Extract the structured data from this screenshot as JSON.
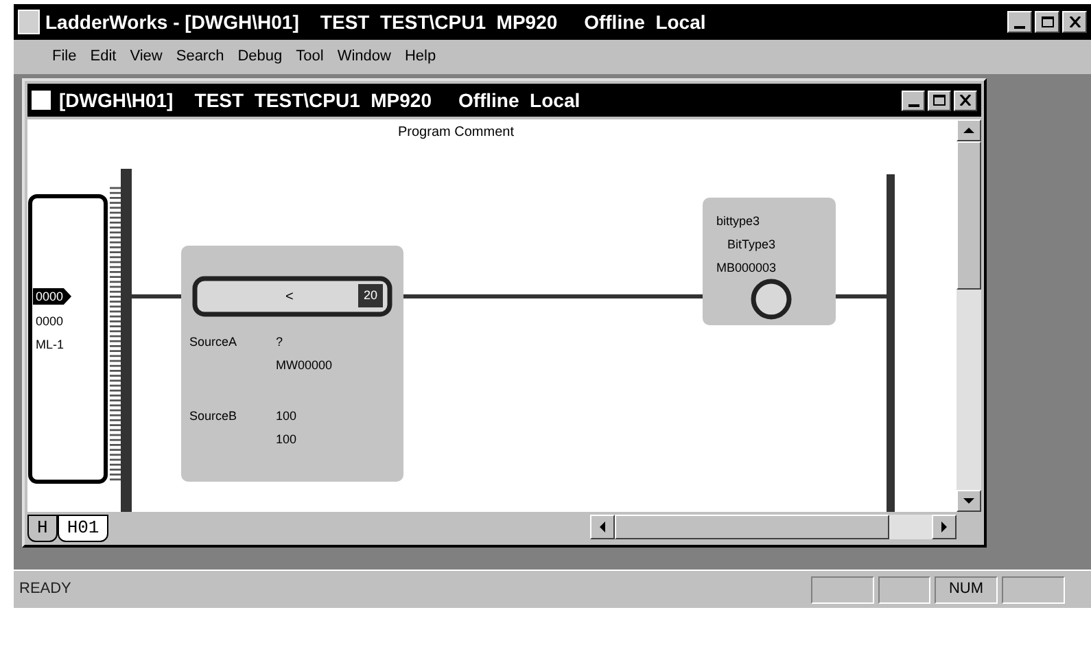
{
  "window": {
    "title": "LadderWorks - [DWGH\\H01]    TEST  TEST\\CPU1  MP920     Offline  Local"
  },
  "menu": [
    "File",
    "Edit",
    "View",
    "Search",
    "Debug",
    "Tool",
    "Window",
    "Help"
  ],
  "child_window": {
    "title": "[DWGH\\H01]    TEST  TEST\\CPU1  MP920     Offline  Local"
  },
  "ladder": {
    "program_comment": "Program Comment",
    "left_block": {
      "selected_label": "0000",
      "lines": [
        "0000",
        "ML-1"
      ]
    },
    "compare": {
      "operator": "<",
      "badge": "20",
      "operands": [
        {
          "name": "SourceA",
          "lines": [
            "?",
            "MW00000"
          ]
        },
        {
          "name": "SourceB",
          "lines": [
            "100",
            "100"
          ]
        }
      ]
    },
    "coil": {
      "lines": [
        "bittype3",
        "BitType3",
        "MB000003"
      ]
    }
  },
  "sheet_tabs": [
    {
      "label": "H",
      "selected": false
    },
    {
      "label": "H01",
      "selected": true
    }
  ],
  "status_bar": {
    "message": "READY",
    "num_indicator": "NUM"
  }
}
